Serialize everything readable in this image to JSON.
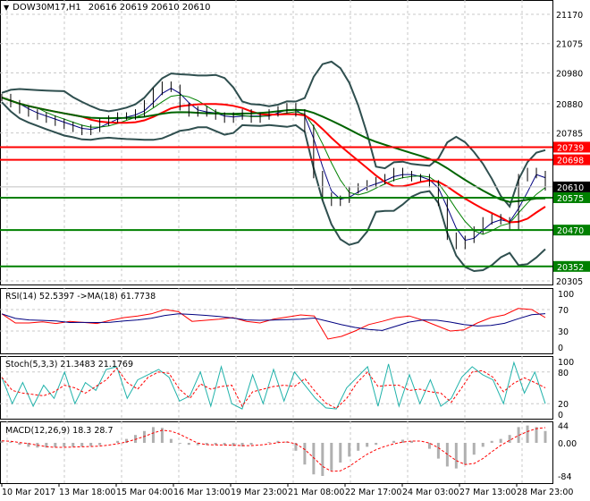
{
  "header": {
    "symbol": "DOW30M17,H1",
    "ohlc": "20616 20619 20610 20610"
  },
  "chart_data": [
    {
      "type": "line",
      "title": "DOW30M17,H1",
      "ylim": [
        20305,
        21170
      ],
      "yticks": [
        21170,
        21075,
        20980,
        20880,
        20785,
        20305
      ],
      "closes": [
        20900,
        20880,
        20860,
        20850,
        20840,
        20830,
        20820,
        20810,
        20800,
        20790,
        20800,
        20820,
        20830,
        20840,
        20840,
        20850,
        20880,
        20920,
        20940,
        20930,
        20870,
        20850,
        20860,
        20850,
        20840,
        20830,
        20840,
        20850,
        20830,
        20840,
        20850,
        20860,
        20870,
        20850,
        20800,
        20650,
        20580,
        20560,
        20570,
        20600,
        20610,
        20620,
        20630,
        20640,
        20660,
        20650,
        20640,
        20640,
        20620,
        20560,
        20450,
        20420,
        20440,
        20470,
        20500,
        20510,
        20500,
        20480,
        20640,
        20660,
        20650,
        20610
      ],
      "levels": [
        {
          "value": 20739,
          "label": "20739",
          "color": "#ff0000"
        },
        {
          "value": 20698,
          "label": "20698",
          "color": "#ff0000"
        },
        {
          "value": 20575,
          "label": "20575",
          "color": "#008000"
        },
        {
          "value": 20470,
          "label": "20470",
          "color": "#008000"
        },
        {
          "value": 20352,
          "label": "20352",
          "color": "#008000"
        }
      ],
      "current": {
        "value": 20610,
        "label": "20610"
      },
      "xticks": [
        "10 Mar 2017",
        "13 Mar 18:00",
        "15 Mar 04:00",
        "16 Mar 13:00",
        "19 Mar 23:00",
        "21 Mar 08:00",
        "22 Mar 17:00",
        "24 Mar 03:00",
        "27 Mar 13:00",
        "28 Mar 23:00"
      ]
    },
    {
      "type": "line",
      "title": "RSI(14) 52.5397  ->MA(18) 61.7738",
      "ylim": [
        0,
        100
      ],
      "yticks": [
        "100",
        "70",
        "30",
        "0"
      ],
      "rsi": [
        62,
        45,
        45,
        47,
        44,
        48,
        46,
        44,
        50,
        55,
        58,
        62,
        70,
        66,
        48,
        50,
        52,
        55,
        48,
        45,
        52,
        56,
        60,
        58,
        15,
        20,
        30,
        42,
        48,
        55,
        58,
        50,
        40,
        30,
        32,
        45,
        55,
        60,
        72,
        70,
        55
      ]
    },
    {
      "type": "line",
      "title": "Stoch(5,3,3) 21.3483 21.1769",
      "ylim": [
        0,
        100
      ],
      "yticks": [
        "100",
        "80",
        "20",
        "0"
      ],
      "main": [
        70,
        20,
        60,
        15,
        55,
        30,
        80,
        20,
        60,
        45,
        85,
        90,
        30,
        65,
        75,
        85,
        70,
        25,
        35,
        80,
        15,
        90,
        20,
        10,
        75,
        20,
        85,
        25,
        80,
        55,
        30,
        12,
        10,
        50,
        70,
        90,
        15,
        95,
        15,
        75,
        20,
        65,
        15,
        30,
        70,
        90,
        75,
        65,
        20,
        98,
        40,
        80,
        20
      ]
    },
    {
      "type": "bar",
      "title": "MACD(12,26,9) 18.3 28.7",
      "ylim": [
        -84,
        44
      ],
      "yticks": [
        "44",
        "0.00",
        "-84"
      ],
      "hist": [
        5,
        3,
        -5,
        -10,
        -12,
        -12,
        -11,
        -10,
        -10,
        -9,
        -8,
        -6,
        0,
        5,
        10,
        20,
        30,
        40,
        38,
        10,
        -2,
        -5,
        -6,
        -5,
        -5,
        -6,
        -8,
        -9,
        -5,
        0,
        2,
        5,
        3,
        -20,
        -55,
        -80,
        -84,
        -70,
        -50,
        -35,
        -20,
        -10,
        -5,
        0,
        5,
        8,
        5,
        0,
        -15,
        -40,
        -60,
        -65,
        -55,
        -30,
        -10,
        5,
        10,
        20,
        40,
        44,
        40,
        30
      ]
    }
  ]
}
